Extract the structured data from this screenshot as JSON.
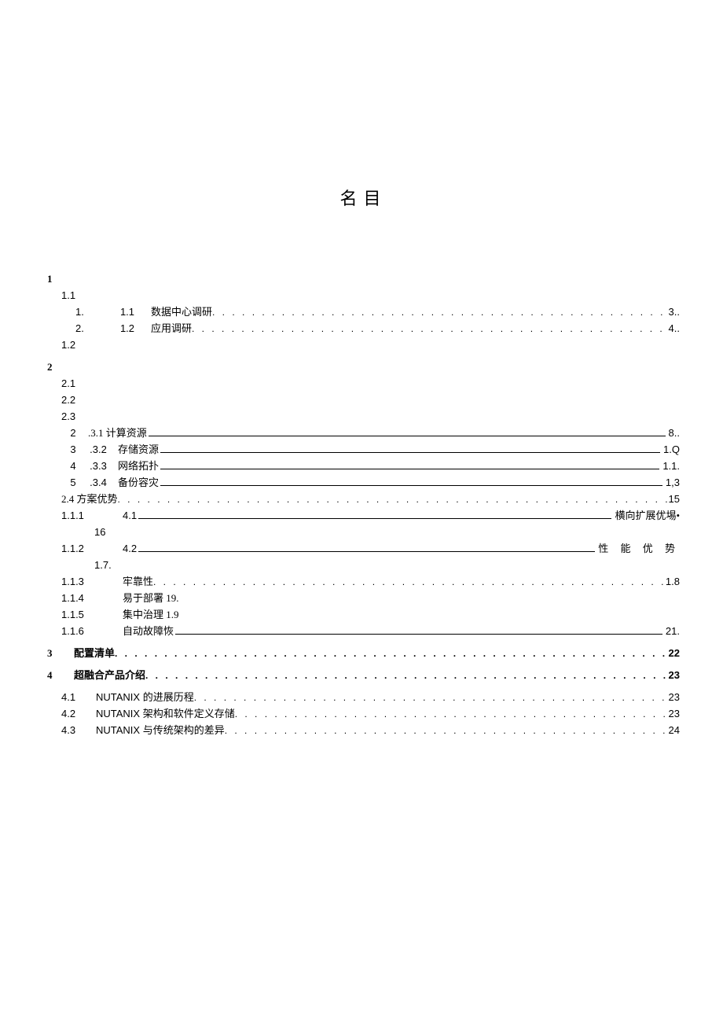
{
  "title": "名目",
  "s1": {
    "num": "1",
    "sub1_1": "1.1",
    "row_a": {
      "idx": "1.",
      "sub": "1.1",
      "label": "数据中心调研",
      "page": "3.."
    },
    "row_b": {
      "idx": "2.",
      "sub": "1.2",
      "label": "应用调研",
      "page": "4.."
    },
    "sub1_2": "1.2"
  },
  "s2": {
    "num": "2",
    "sub2_1": "2.1",
    "sub2_2": "2.2",
    "sub2_3": "2.3",
    "r1": {
      "idx": "2",
      "sub": ".3.1 计算资源",
      "page": "8.."
    },
    "r2": {
      "idx": "3",
      "sub": ".3.2",
      "label": "存储资源",
      "page": "1.Q"
    },
    "r3": {
      "idx": "4",
      "sub": ".3.3",
      "label": "网络拓扑",
      "page": "1.1."
    },
    "r4": {
      "idx": "5",
      "sub": ".3.4",
      "label": "备份容灾",
      "page": "1,3"
    },
    "adv": {
      "label": "2.4 方案优势",
      "page": "15"
    },
    "a1": {
      "idx": "1.1.1",
      "sub": "4.1",
      "tail": "横向扩展优埸•",
      "line2": "16"
    },
    "a2": {
      "idx": "1.1.2",
      "sub": "4.2",
      "tail": "性 能 优 势",
      "line2": "1.7."
    },
    "a3": {
      "idx": "1.1.3",
      "label": "牢靠性",
      "page": "1.8"
    },
    "a4": {
      "idx": "1.1.4",
      "label": "易于部署 19."
    },
    "a5": {
      "idx": "1.1.5",
      "label": "集中治理 1.9"
    },
    "a6": {
      "idx": "1.1.6",
      "label": "自动故障恢",
      "page": "21."
    }
  },
  "s3": {
    "num": "3",
    "label": "配置清单",
    "page": "22"
  },
  "s4": {
    "num": "4",
    "label": " 超融合产品介绍",
    "page": "23",
    "r1": {
      "idx": "4.1",
      "label": "NUTANIX 的进展历程",
      "page": "23"
    },
    "r2": {
      "idx": "4.2",
      "label": "NUTANIX 架构和软件定义存储",
      "page": "23"
    },
    "r3": {
      "idx": "4.3",
      "label": "NUTANIX 与传统架构的差异",
      "page": "24"
    }
  }
}
